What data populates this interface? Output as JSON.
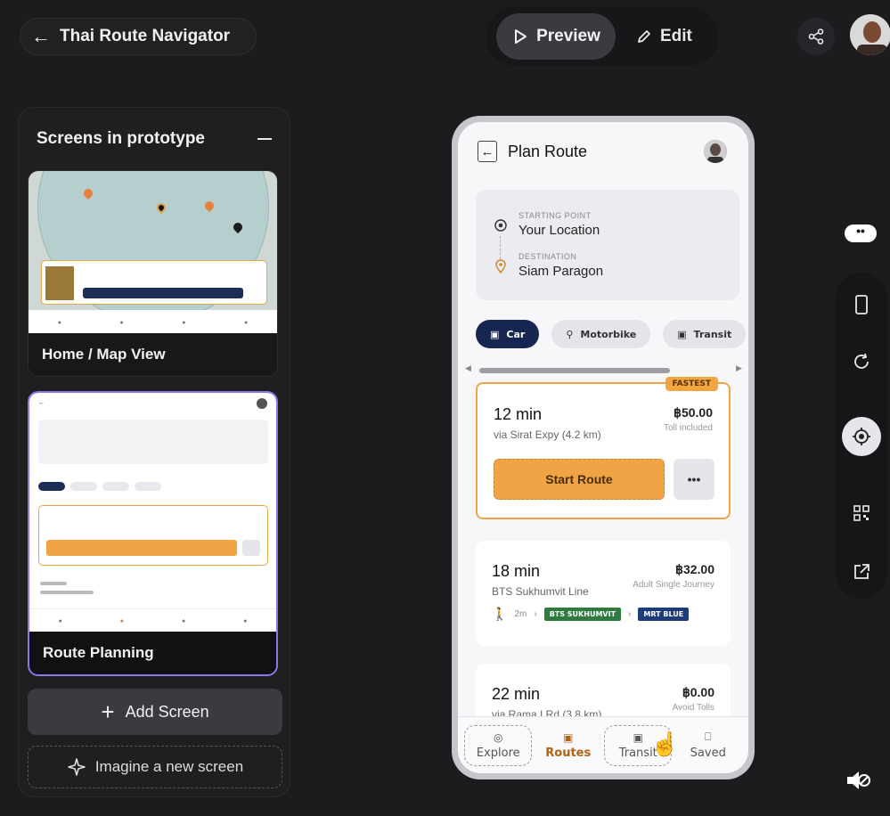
{
  "app": {
    "title": "Thai Route Navigator",
    "preview_label": "Preview",
    "edit_label": "Edit",
    "icons": {
      "back": "back-arrow-icon",
      "preview": "play-icon",
      "edit": "pencil-icon",
      "share": "share-icon"
    }
  },
  "sidebar": {
    "title": "Screens in prototype",
    "screens": [
      {
        "label": "Home / Map View",
        "selected": false
      },
      {
        "label": "Route Planning",
        "selected": true
      }
    ],
    "add_screen_label": "Add Screen",
    "imagine_label": "Imagine a new screen"
  },
  "phone": {
    "header_title": "Plan Route",
    "starting_point_label": "STARTING POINT",
    "starting_point_value": "Your Location",
    "destination_label": "DESTINATION",
    "destination_value": "Siam Paragon",
    "modes": [
      {
        "label": "Car",
        "active": true
      },
      {
        "label": "Motorbike",
        "active": false
      },
      {
        "label": "Transit",
        "active": false
      }
    ],
    "routes": [
      {
        "badge": "FASTEST",
        "time": "12 min",
        "via": "via Sirat Expy (4.2 km)",
        "price": "฿50.00",
        "note": "Toll included",
        "action": "Start Route",
        "more": "•••"
      },
      {
        "time": "18 min",
        "via": "BTS Sukhumvit Line",
        "price": "฿32.00",
        "note": "Adult Single Journey",
        "walk": "2m",
        "line1": "BTS SUKHUMVIT",
        "line2": "MRT BLUE"
      },
      {
        "time": "22 min",
        "via": "via Rama I Rd (3.8 km)",
        "price": "฿0.00",
        "note": "Avoid Tolls"
      }
    ],
    "nav": [
      {
        "label": "Explore",
        "icon": "compass-icon"
      },
      {
        "label": "Routes",
        "icon": "car-icon",
        "active": true
      },
      {
        "label": "Transit",
        "icon": "train-icon"
      },
      {
        "label": "Saved",
        "icon": "bookmark-icon"
      }
    ],
    "accent_color": "#f0a445",
    "primary_color": "#172651"
  },
  "rail": {
    "more_label": "••",
    "tools": [
      "phone-frame-icon",
      "refresh-icon",
      "target-icon",
      "qr-code-icon",
      "open-external-icon"
    ]
  }
}
